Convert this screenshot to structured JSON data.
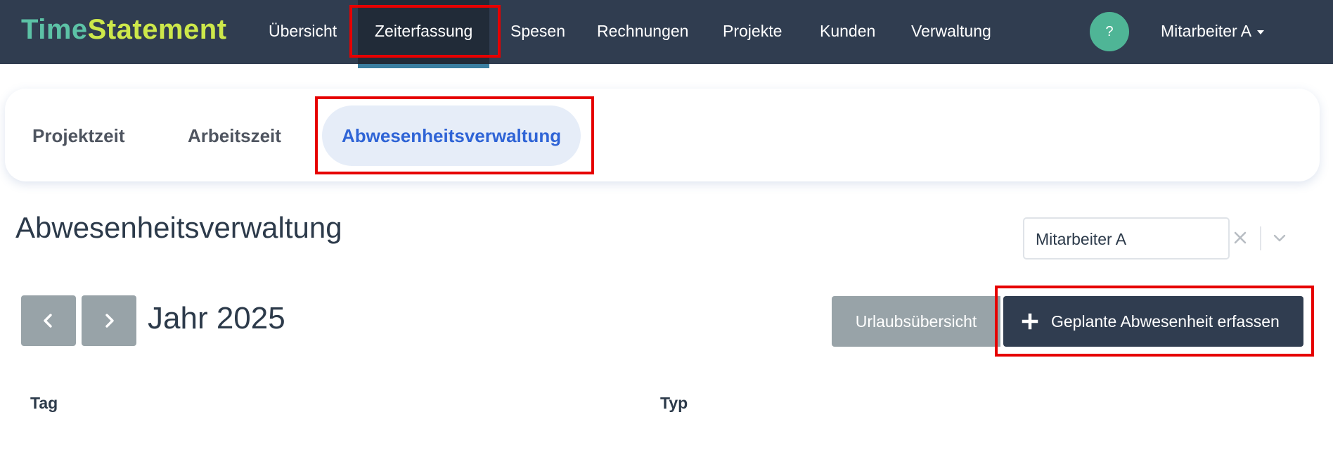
{
  "brand": {
    "part1": "Time",
    "part2": "Statement"
  },
  "nav": {
    "items": [
      {
        "label": "Übersicht"
      },
      {
        "label": "Zeiterfassung"
      },
      {
        "label": "Spesen"
      },
      {
        "label": "Rechnungen"
      },
      {
        "label": "Projekte"
      },
      {
        "label": "Kunden"
      },
      {
        "label": "Verwaltung"
      }
    ],
    "active": "Zeiterfassung",
    "help_label": "?",
    "user": "Mitarbeiter A"
  },
  "tabs": {
    "items": [
      {
        "label": "Projektzeit"
      },
      {
        "label": "Arbeitszeit"
      },
      {
        "label": "Abwesenheitsverwaltung"
      }
    ],
    "active": "Abwesenheitsverwaltung"
  },
  "page": {
    "title": "Abwesenheitsverwaltung",
    "employee_select": {
      "value": "Mitarbeiter A"
    },
    "year_label": "Jahr 2025",
    "buttons": {
      "vacation_overview": "Urlaubsübersicht",
      "add_planned_absence": "Geplante Abwesenheit erfassen"
    },
    "table": {
      "columns": [
        "Tag",
        "Typ"
      ]
    }
  },
  "colors": {
    "navbar": "#303d50",
    "brand_time": "#5cc2a6",
    "brand_statement": "#cde84a",
    "active_tab_text": "#2f64d6",
    "highlight": "#e60000",
    "primary_button": "#303d50",
    "secondary_button": "#98a3a8"
  },
  "icons": [
    "question-icon",
    "caret-down-icon",
    "clear-icon",
    "chevron-down-icon",
    "chevron-left-icon",
    "chevron-right-icon",
    "plus-icon"
  ]
}
